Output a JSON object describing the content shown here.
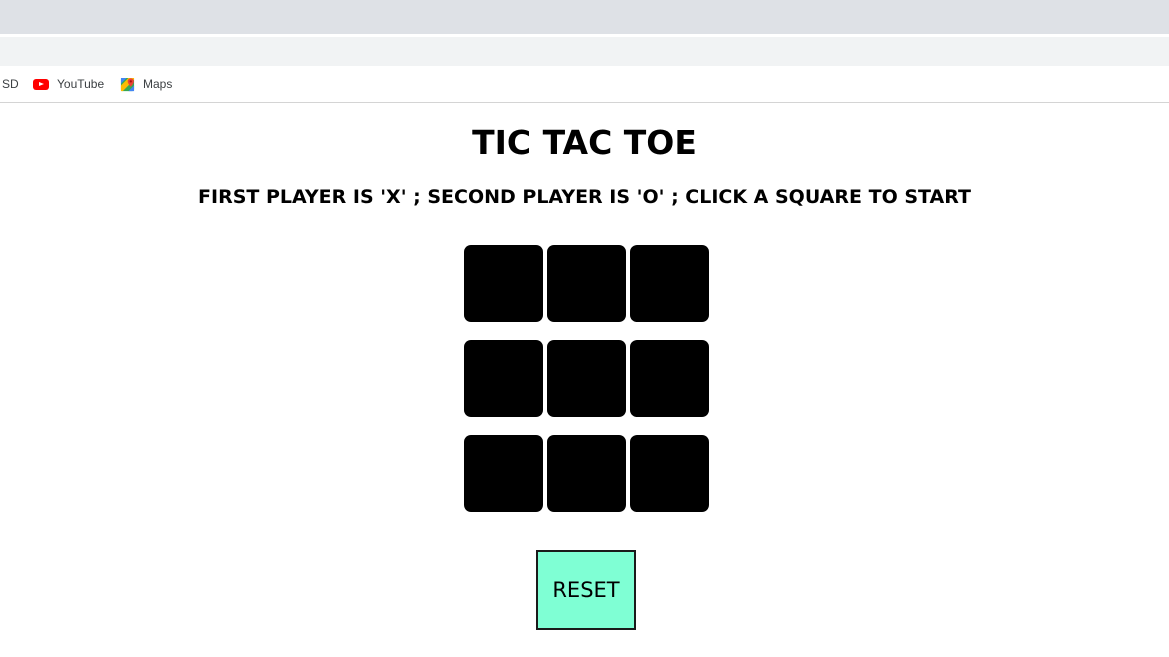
{
  "bookmarks": {
    "items": [
      {
        "label": "SD"
      },
      {
        "label": "YouTube",
        "icon": "youtube-icon"
      },
      {
        "label": "Maps",
        "icon": "maps-icon"
      }
    ]
  },
  "game": {
    "title": "TIC TAC TOE",
    "instructions": "FIRST PLAYER IS 'X' ; SECOND PLAYER IS 'O' ; CLICK A SQUARE TO START",
    "board": [
      [
        "",
        "",
        ""
      ],
      [
        "",
        "",
        ""
      ],
      [
        "",
        "",
        ""
      ]
    ],
    "reset_label": "RESET"
  },
  "colors": {
    "cell": "#000000",
    "reset_button": "#7fffd4",
    "youtube_red": "#ff0000"
  }
}
